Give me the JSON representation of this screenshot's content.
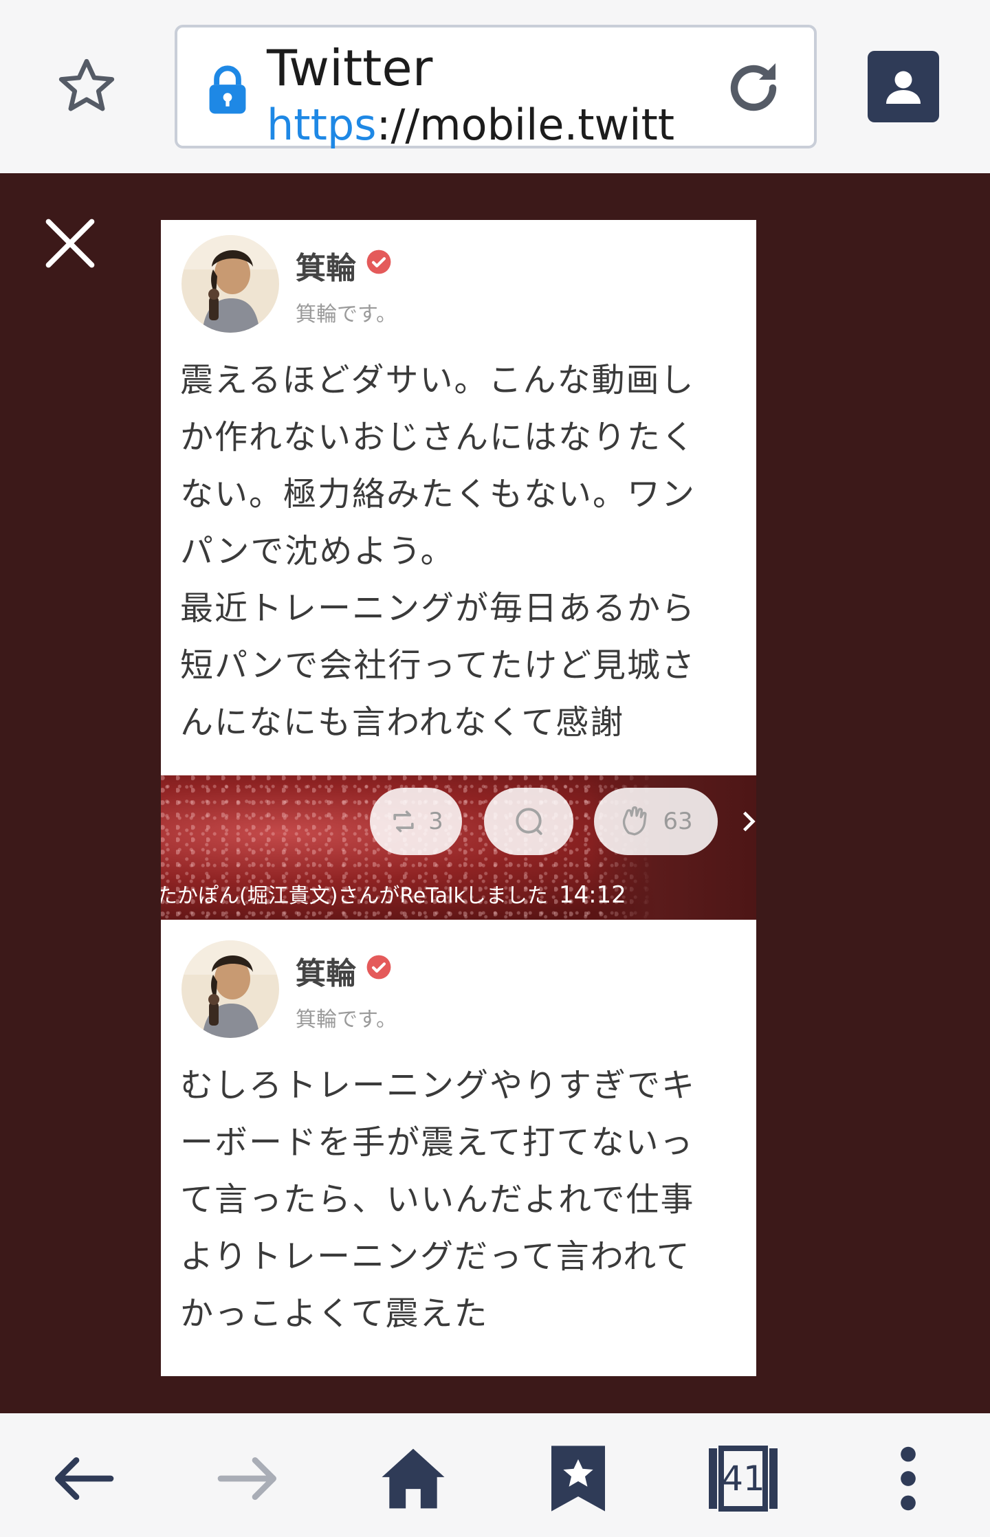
{
  "browser": {
    "page_title": "Twitter",
    "url_scheme": "https",
    "url_rest": "://mobile.twitt…",
    "tab_count": "41"
  },
  "posts": [
    {
      "user_name": "箕輪",
      "user_sub": "箕輪です。",
      "text": "震えるほどダサい。こんな動画し\nか作れないおじさんにはなりたく\nない。極力絡みたくもない。ワン\nパンで沈めよう。\n最近トレーニングが毎日あるから\n短パンで会社行ってたけど見城さ\nんになにも言われなくて感謝"
    },
    {
      "user_name": "箕輪",
      "user_sub": "箕輪です。",
      "text": "むしろトレーニングやりすぎでキ\nーボードを手が震えて打てないっ\nて言ったら、いいんだよれで仕事\nよりトレーニングだって言われて\nかっこよくて震えた"
    }
  ],
  "actions": {
    "retalk_count": "3",
    "clap_count": "63"
  },
  "retalk_caption": {
    "text": "たかぽん(堀江貴文)さんがReTalkしました",
    "time": "14:12"
  },
  "colors": {
    "viewer_bg": "#3c1919",
    "accent_blue": "#1e88e5",
    "nav_icon": "#2f3b57",
    "verified_red": "#e45a5a"
  },
  "icons": {
    "bookmark": "star-outline-icon",
    "lock": "lock-icon",
    "reload": "reload-icon",
    "profile": "profile-icon",
    "close": "close-icon",
    "retalk": "retalk-icon",
    "comment": "comment-icon",
    "clap": "clap-icon",
    "back": "back-arrow-icon",
    "forward": "forward-arrow-icon",
    "home": "home-icon",
    "bookmarks": "bookmark-star-icon",
    "tabs": "tabs-icon",
    "menu": "more-vert-icon"
  }
}
